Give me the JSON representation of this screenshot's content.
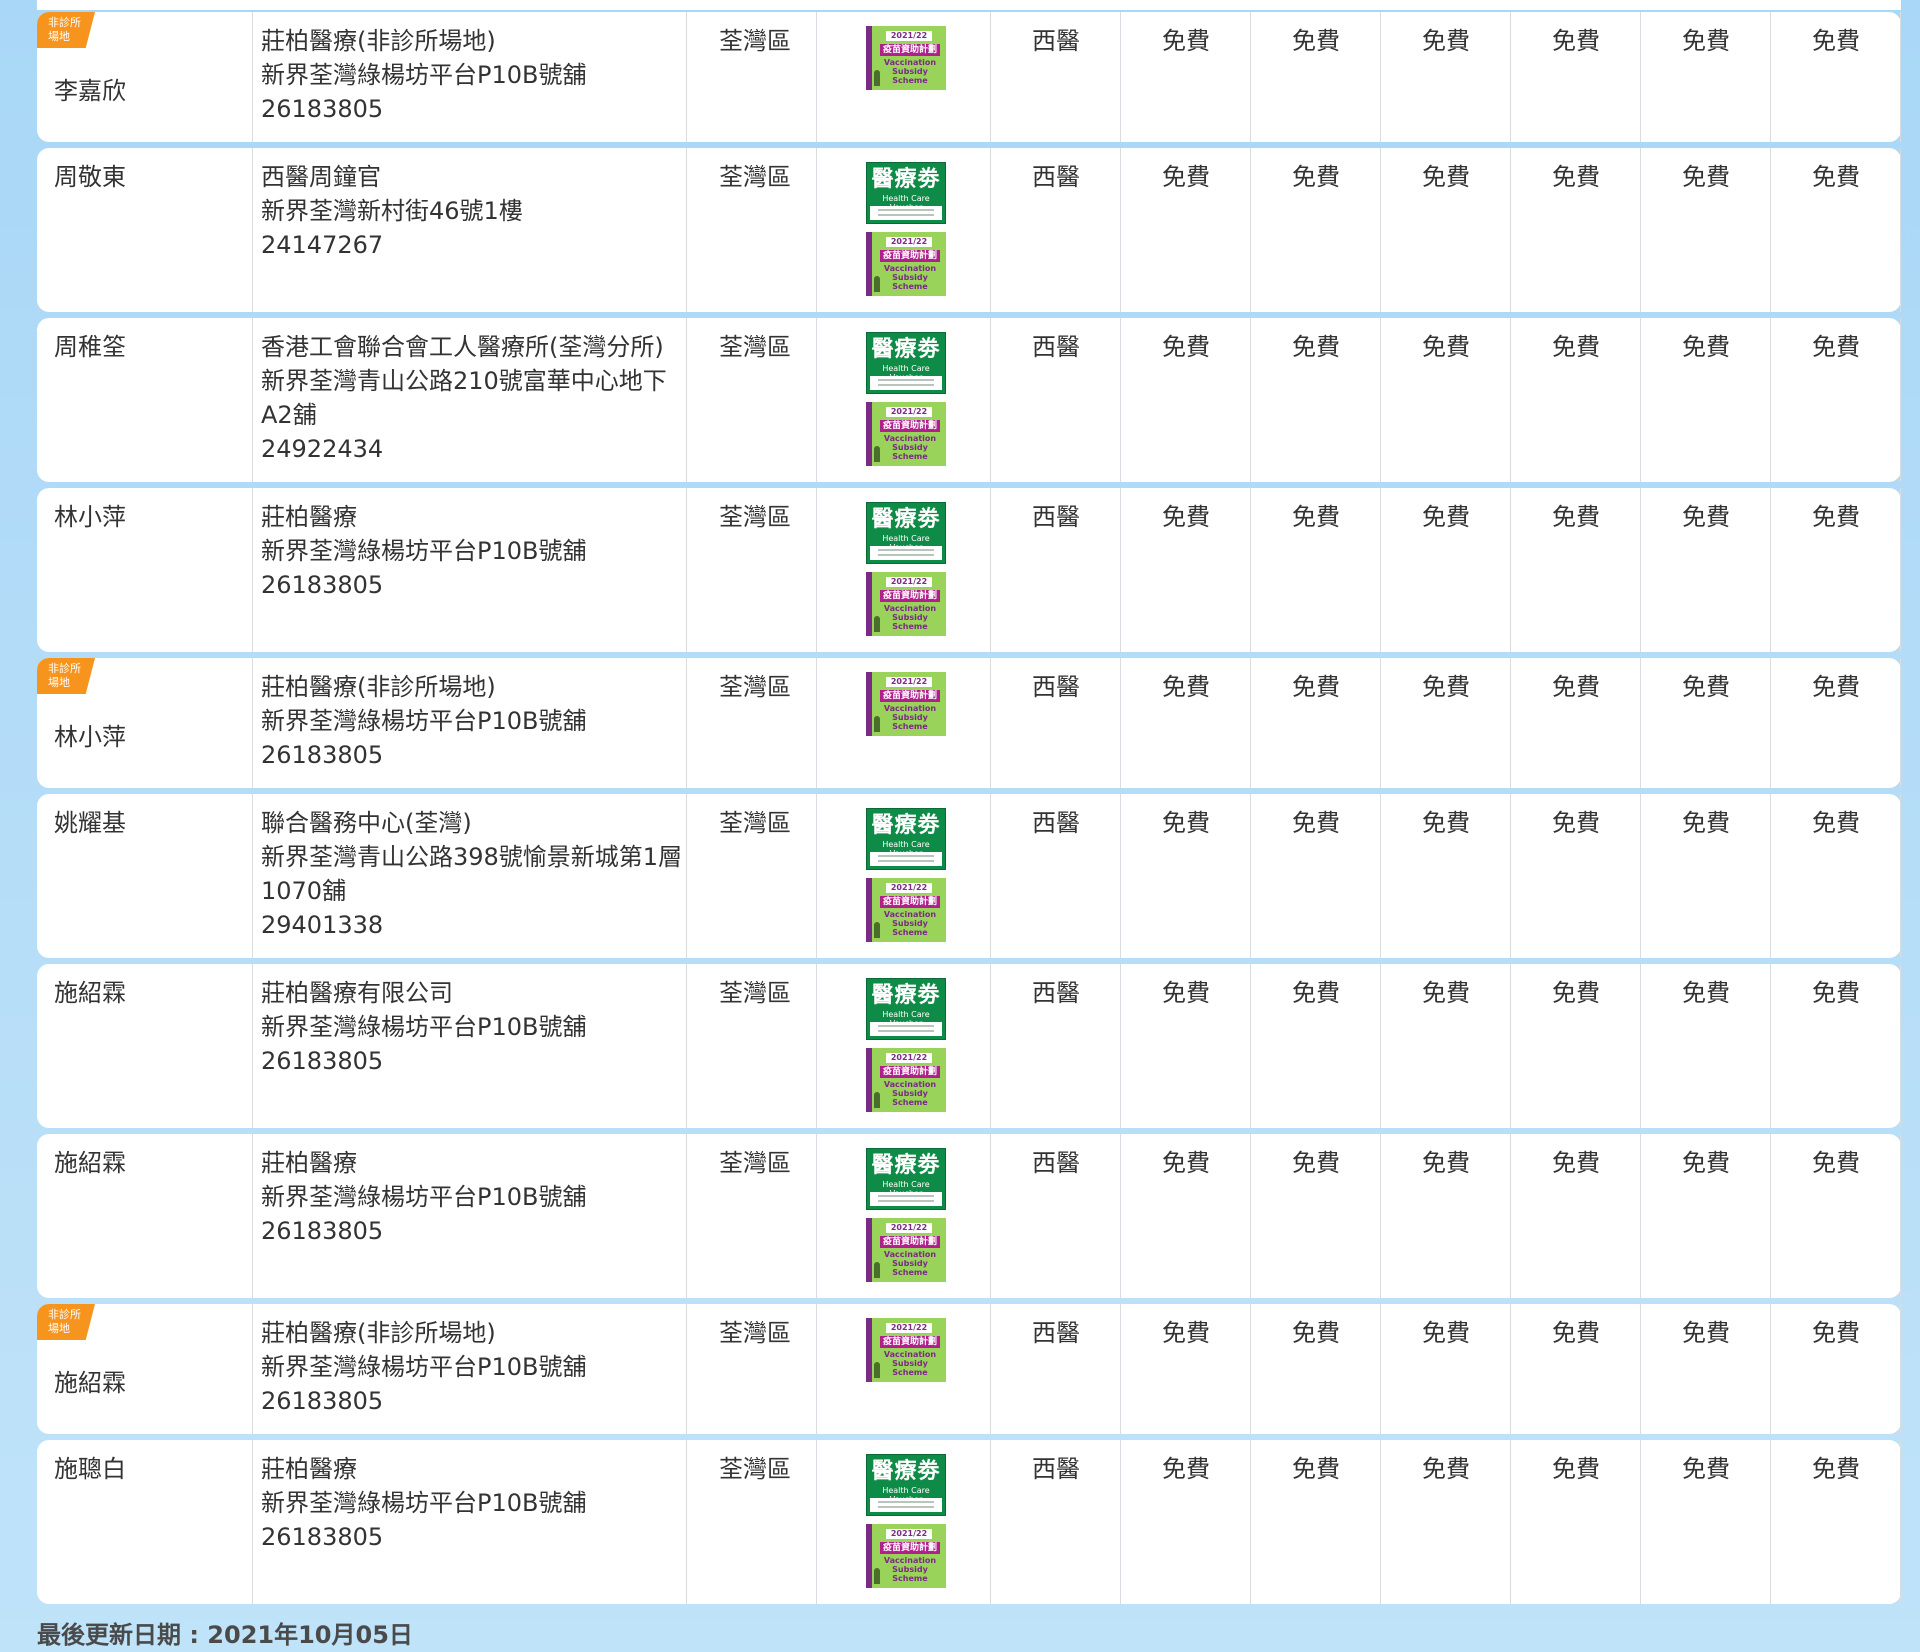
{
  "icons": {
    "health_care_voucher": {
      "title": "醫療劵",
      "subtitle": "Health Care Voucher"
    },
    "vaccination_subsidy": {
      "year": "2021/22",
      "title_zh": "疫苗資助計劃",
      "title_en_1": "Vaccination",
      "title_en_2": "Subsidy Scheme"
    }
  },
  "badge": {
    "line1": "非診所",
    "line2": "場地",
    "color": "#f7941d"
  },
  "rows": [
    {
      "badge": true,
      "name": "李嘉欣",
      "clinic": "莊柏醫療(非診所場地)",
      "address": "新界荃灣綠楊坊平台P10B號舖",
      "address2": "",
      "phone": "26183805",
      "district": "荃灣區",
      "hcv": false,
      "vss": true,
      "type": "西醫",
      "fees": [
        "免費",
        "免費",
        "免費",
        "免費",
        "免費",
        "免費"
      ]
    },
    {
      "badge": false,
      "name": "周敬東",
      "clinic": "西醫周鐘官",
      "address": "新界荃灣新村街46號1樓",
      "address2": "",
      "phone": "24147267",
      "district": "荃灣區",
      "hcv": true,
      "vss": true,
      "type": "西醫",
      "fees": [
        "免費",
        "免費",
        "免費",
        "免費",
        "免費",
        "免費"
      ]
    },
    {
      "badge": false,
      "name": "周稚筌",
      "clinic": "香港工會聯合會工人醫療所(荃灣分所)",
      "address": "新界荃灣青山公路210號富華中心地下",
      "address2": "A2舖",
      "phone": "24922434",
      "district": "荃灣區",
      "hcv": true,
      "vss": true,
      "type": "西醫",
      "fees": [
        "免費",
        "免費",
        "免費",
        "免費",
        "免費",
        "免費"
      ]
    },
    {
      "badge": false,
      "name": "林小萍",
      "clinic": "莊柏醫療",
      "address": "新界荃灣綠楊坊平台P10B號舖",
      "address2": "",
      "phone": "26183805",
      "district": "荃灣區",
      "hcv": true,
      "vss": true,
      "type": "西醫",
      "fees": [
        "免費",
        "免費",
        "免費",
        "免費",
        "免費",
        "免費"
      ]
    },
    {
      "badge": true,
      "name": "林小萍",
      "clinic": "莊柏醫療(非診所場地)",
      "address": "新界荃灣綠楊坊平台P10B號舖",
      "address2": "",
      "phone": "26183805",
      "district": "荃灣區",
      "hcv": false,
      "vss": true,
      "type": "西醫",
      "fees": [
        "免費",
        "免費",
        "免費",
        "免費",
        "免費",
        "免費"
      ]
    },
    {
      "badge": false,
      "name": "姚耀基",
      "clinic": "聯合醫務中心(荃灣)",
      "address": "新界荃灣青山公路398號愉景新城第1層",
      "address2": "1070舖",
      "phone": "29401338",
      "district": "荃灣區",
      "hcv": true,
      "vss": true,
      "type": "西醫",
      "fees": [
        "免費",
        "免費",
        "免費",
        "免費",
        "免費",
        "免費"
      ]
    },
    {
      "badge": false,
      "name": "施紹霖",
      "clinic": "莊柏醫療有限公司",
      "address": "新界荃灣綠楊坊平台P10B號舖",
      "address2": "",
      "phone": "26183805",
      "district": "荃灣區",
      "hcv": true,
      "vss": true,
      "type": "西醫",
      "fees": [
        "免費",
        "免費",
        "免費",
        "免費",
        "免費",
        "免費"
      ]
    },
    {
      "badge": false,
      "name": "施紹霖",
      "clinic": "莊柏醫療",
      "address": "新界荃灣綠楊坊平台P10B號舖",
      "address2": "",
      "phone": "26183805",
      "district": "荃灣區",
      "hcv": true,
      "vss": true,
      "type": "西醫",
      "fees": [
        "免費",
        "免費",
        "免費",
        "免費",
        "免費",
        "免費"
      ]
    },
    {
      "badge": true,
      "name": "施紹霖",
      "clinic": "莊柏醫療(非診所場地)",
      "address": "新界荃灣綠楊坊平台P10B號舖",
      "address2": "",
      "phone": "26183805",
      "district": "荃灣區",
      "hcv": false,
      "vss": true,
      "type": "西醫",
      "fees": [
        "免費",
        "免費",
        "免費",
        "免費",
        "免費",
        "免費"
      ]
    },
    {
      "badge": false,
      "name": "施聰白",
      "clinic": "莊柏醫療",
      "address": "新界荃灣綠楊坊平台P10B號舖",
      "address2": "",
      "phone": "26183805",
      "district": "荃灣區",
      "hcv": true,
      "vss": true,
      "type": "西醫",
      "fees": [
        "免費",
        "免費",
        "免費",
        "免費",
        "免費",
        "免費"
      ]
    }
  ],
  "footer": {
    "last_updated": "最後更新日期 : 2021年10月05日"
  }
}
